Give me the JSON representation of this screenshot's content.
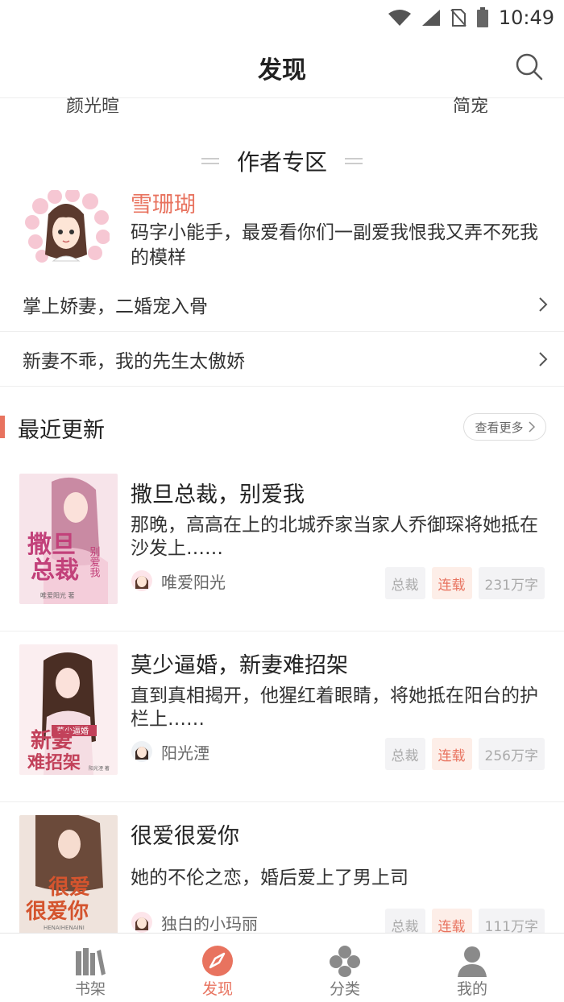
{
  "status_bar": {
    "time": "10:49"
  },
  "header": {
    "title": "发现"
  },
  "partial_names": [
    "颜光暄",
    "简宠"
  ],
  "author_zone": {
    "title": "作者专区",
    "author": {
      "name": "雪珊瑚",
      "bio": "码字小能手，最爱看你们一副爱我恨我又弄不死我的模样"
    },
    "books": [
      "掌上娇妻，二婚宠入骨",
      "新妻不乖，我的先生太傲娇"
    ]
  },
  "recent": {
    "title": "最近更新",
    "more_label": "查看更多",
    "books": [
      {
        "title": "撒旦总裁，别爱我",
        "desc": "那晚，高高在上的北城乔家当家人乔御琛将她抵在沙发上……",
        "author": "唯爱阳光",
        "tags": [
          "总裁",
          "连载",
          "231万字"
        ],
        "cover_text": [
          "撒旦",
          "总裁",
          "别爱我",
          "唯爱阳光 著"
        ]
      },
      {
        "title": "莫少逼婚，新妻难招架",
        "desc": "直到真相揭开，他猩红着眼睛，将她抵在阳台的护栏上……",
        "author": "阳光湮",
        "tags": [
          "总裁",
          "连载",
          "256万字"
        ],
        "cover_text": [
          "莫少逼婚",
          "新妻",
          "难招架",
          "阳光湮 著"
        ]
      },
      {
        "title": "很爱很爱你",
        "desc": "她的不伦之恋，婚后爱上了男上司",
        "author": "独白的小玛丽",
        "tags": [
          "总裁",
          "连载",
          "111万字"
        ],
        "cover_text": [
          "很爱",
          "很爱你",
          "HENAIHENAINI"
        ]
      }
    ]
  },
  "tabbar": {
    "items": [
      {
        "label": "书架",
        "icon": "bookshelf-icon"
      },
      {
        "label": "发现",
        "icon": "compass-icon"
      },
      {
        "label": "分类",
        "icon": "category-icon"
      },
      {
        "label": "我的",
        "icon": "user-icon"
      }
    ],
    "active": "发现"
  },
  "colors": {
    "accent": "#e8735f",
    "status_tag_bg": "#fdeee8",
    "tag_bg": "#f3f3f5"
  }
}
